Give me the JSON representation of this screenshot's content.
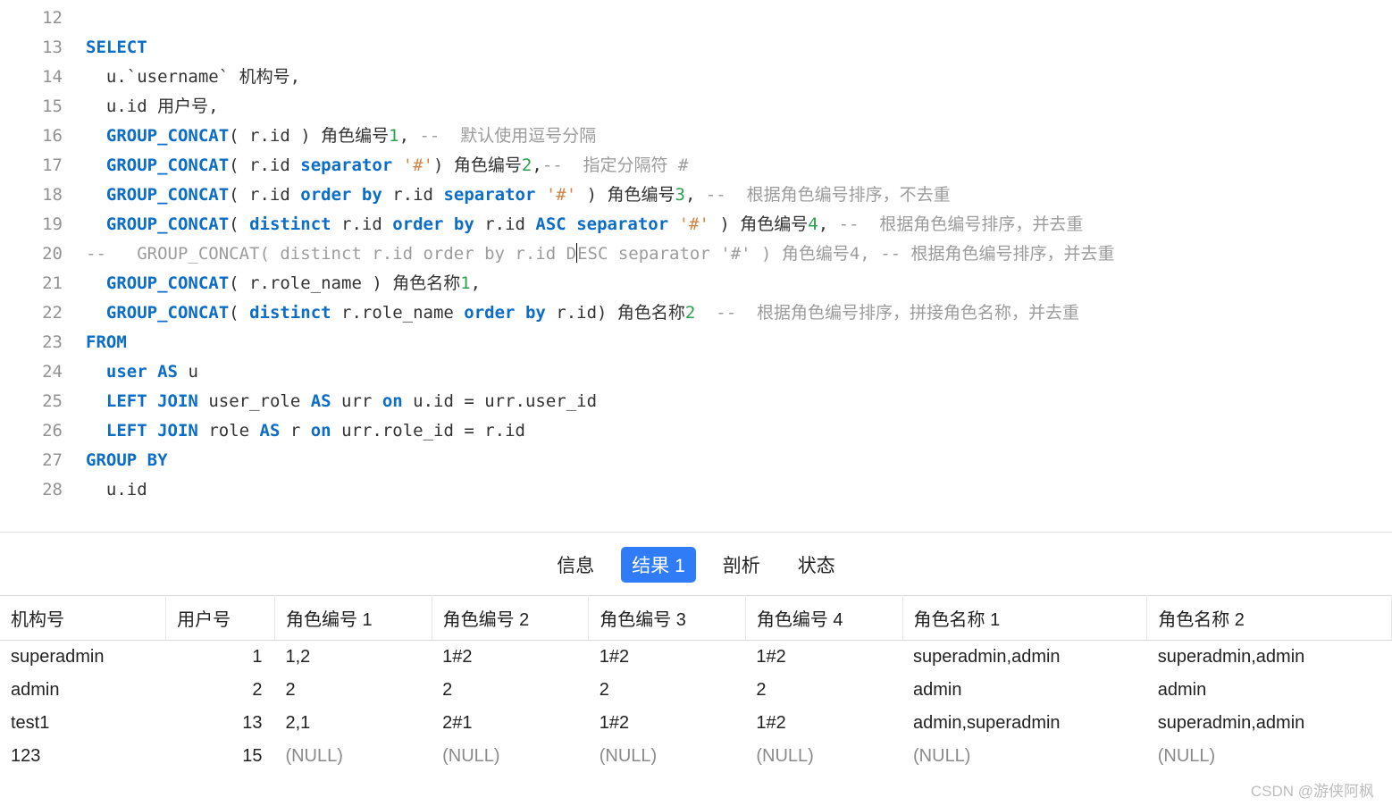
{
  "code_lines": {
    "12": [
      ""
    ],
    "13": [
      [
        "kw",
        "SELECT"
      ]
    ],
    "14": [
      "  u.`username` 机构号,"
    ],
    "15": [
      "  u.id 用户号,"
    ],
    "16": [
      "  ",
      [
        "kw",
        "GROUP_CONCAT"
      ],
      "( r.id ) 角色编号",
      [
        "num",
        "1"
      ],
      ", ",
      [
        "cm",
        "--  默认使用逗号分隔"
      ]
    ],
    "17": [
      "  ",
      [
        "kw",
        "GROUP_CONCAT"
      ],
      "( r.id ",
      [
        "kw",
        "separator"
      ],
      " ",
      [
        "str",
        "'#'"
      ],
      ") 角色编号",
      [
        "num",
        "2"
      ],
      ",",
      [
        "cm",
        "--  指定分隔符 #"
      ]
    ],
    "18": [
      "  ",
      [
        "kw",
        "GROUP_CONCAT"
      ],
      "( r.id ",
      [
        "kw",
        "order"
      ],
      " ",
      [
        "kw",
        "by"
      ],
      " r.id ",
      [
        "kw",
        "separator"
      ],
      " ",
      [
        "str",
        "'#'"
      ],
      " ) 角色编号",
      [
        "num",
        "3"
      ],
      ", ",
      [
        "cm",
        "--  根据角色编号排序，不去重"
      ]
    ],
    "19": [
      "  ",
      [
        "kw",
        "GROUP_CONCAT"
      ],
      "( ",
      [
        "kw",
        "distinct"
      ],
      " r.id ",
      [
        "kw",
        "order"
      ],
      " ",
      [
        "kw",
        "by"
      ],
      " r.id ",
      [
        "kw",
        "ASC"
      ],
      " ",
      [
        "kw",
        "separator"
      ],
      " ",
      [
        "str",
        "'#'"
      ],
      " ) 角色编号",
      [
        "num",
        "4"
      ],
      ", ",
      [
        "cm",
        "--  根据角色编号排序，并去重"
      ]
    ],
    "20": [
      [
        "cm",
        "--   GROUP_CONCAT( distinct r.id order by r.id D"
      ],
      [
        "caret",
        ""
      ],
      [
        "cm",
        "ESC separator '#' ) 角色编号4, -- 根据角色编号排序，并去重"
      ]
    ],
    "21": [
      "  ",
      [
        "kw",
        "GROUP_CONCAT"
      ],
      "( r.role_name ) 角色名称",
      [
        "num",
        "1"
      ],
      ","
    ],
    "22": [
      "  ",
      [
        "kw",
        "GROUP_CONCAT"
      ],
      "( ",
      [
        "kw",
        "distinct"
      ],
      " r.role_name ",
      [
        "kw",
        "order"
      ],
      " ",
      [
        "kw",
        "by"
      ],
      " r.id) 角色名称",
      [
        "num",
        "2"
      ],
      "  ",
      [
        "cm",
        "--  根据角色编号排序，拼接角色名称，并去重"
      ]
    ],
    "23": [
      [
        "kw",
        "FROM"
      ]
    ],
    "24": [
      "  ",
      [
        "kw",
        "user"
      ],
      " ",
      [
        "kw",
        "AS"
      ],
      " u"
    ],
    "25": [
      "  ",
      [
        "kw",
        "LEFT"
      ],
      " ",
      [
        "kw",
        "JOIN"
      ],
      " user_role ",
      [
        "kw",
        "AS"
      ],
      " urr ",
      [
        "kw",
        "on"
      ],
      " u.id = urr.user_id"
    ],
    "26": [
      "  ",
      [
        "kw",
        "LEFT"
      ],
      " ",
      [
        "kw",
        "JOIN"
      ],
      " role ",
      [
        "kw",
        "AS"
      ],
      " r ",
      [
        "kw",
        "on"
      ],
      " urr.role_id = r.id"
    ],
    "27": [
      [
        "kw",
        "GROUP"
      ],
      " ",
      [
        "kw",
        "BY"
      ]
    ],
    "28": [
      "  u.id"
    ]
  },
  "line_order": [
    "12",
    "13",
    "14",
    "15",
    "16",
    "17",
    "18",
    "19",
    "20",
    "21",
    "22",
    "23",
    "24",
    "25",
    "26",
    "27",
    "28"
  ],
  "tabs": {
    "info": "信息",
    "result1": "结果 1",
    "profile": "剖析",
    "status": "状态",
    "active": "result1"
  },
  "table": {
    "headers": [
      "机构号",
      "用户号",
      "角色编号 1",
      "角色编号 2",
      "角色编号 3",
      "角色编号 4",
      "角色名称 1",
      "角色名称 2"
    ],
    "rows": [
      [
        "superadmin",
        "1",
        "1,2",
        "1#2",
        "1#2",
        "1#2",
        "superadmin,admin",
        "superadmin,admin"
      ],
      [
        "admin",
        "2",
        "2",
        "2",
        "2",
        "2",
        "admin",
        "admin"
      ],
      [
        "test1",
        "13",
        "2,1",
        "2#1",
        "1#2",
        "1#2",
        "admin,superadmin",
        "superadmin,admin"
      ],
      [
        "123",
        "15",
        "(NULL)",
        "(NULL)",
        "(NULL)",
        "(NULL)",
        "(NULL)",
        "(NULL)"
      ]
    ]
  },
  "watermark": "CSDN @游侠阿枫"
}
